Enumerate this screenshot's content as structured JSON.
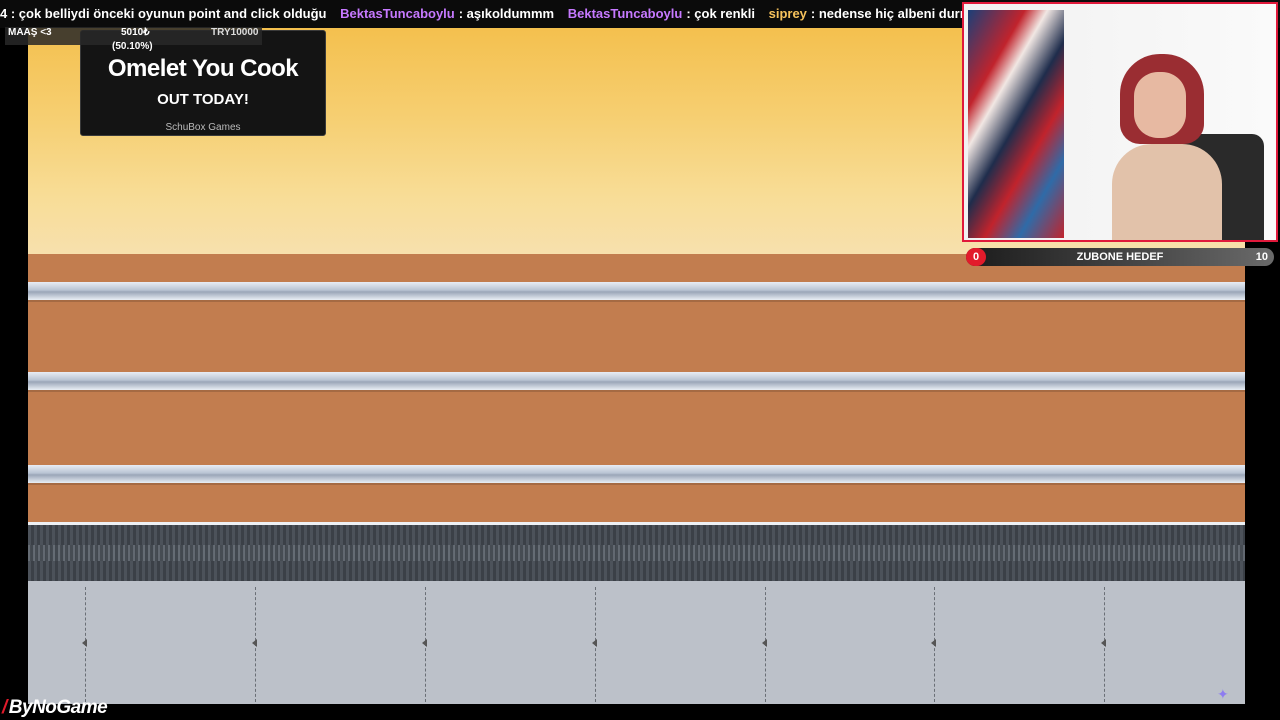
{
  "chat_ticker": {
    "messages": [
      {
        "user": "",
        "text": "4 : çok belliydi önceki oyunun point and click olduğu"
      },
      {
        "user": "BektasTuncaboylu",
        "text": ": aşıkoldummm"
      },
      {
        "user": "BektasTuncaboylu",
        "text": ": çok renkli"
      },
      {
        "user": "siprey",
        "text": ": nedense hiç albeni durmuyor oyu"
      }
    ],
    "colors": {
      "user": "#c679ff",
      "user_alt": "#f6c25c"
    }
  },
  "salary_overlay": {
    "label": "MAAŞ <3",
    "amount": "5010₺",
    "percent": "(50.10%)",
    "goal": "TRY10000"
  },
  "promo": {
    "title": "Omelet You Cook",
    "subtitle": "OUT TODAY!",
    "studio": "SchuBox Games"
  },
  "sub_goal": {
    "start": "0",
    "label": "ZUBONE HEDEF",
    "end": "10",
    "progress": 0.0
  },
  "logo": {
    "text": "ByNoGame",
    "accent": "#e21b2b"
  },
  "colors": {
    "webcam_border": "#e0193b",
    "wall": "#c27d4f"
  }
}
